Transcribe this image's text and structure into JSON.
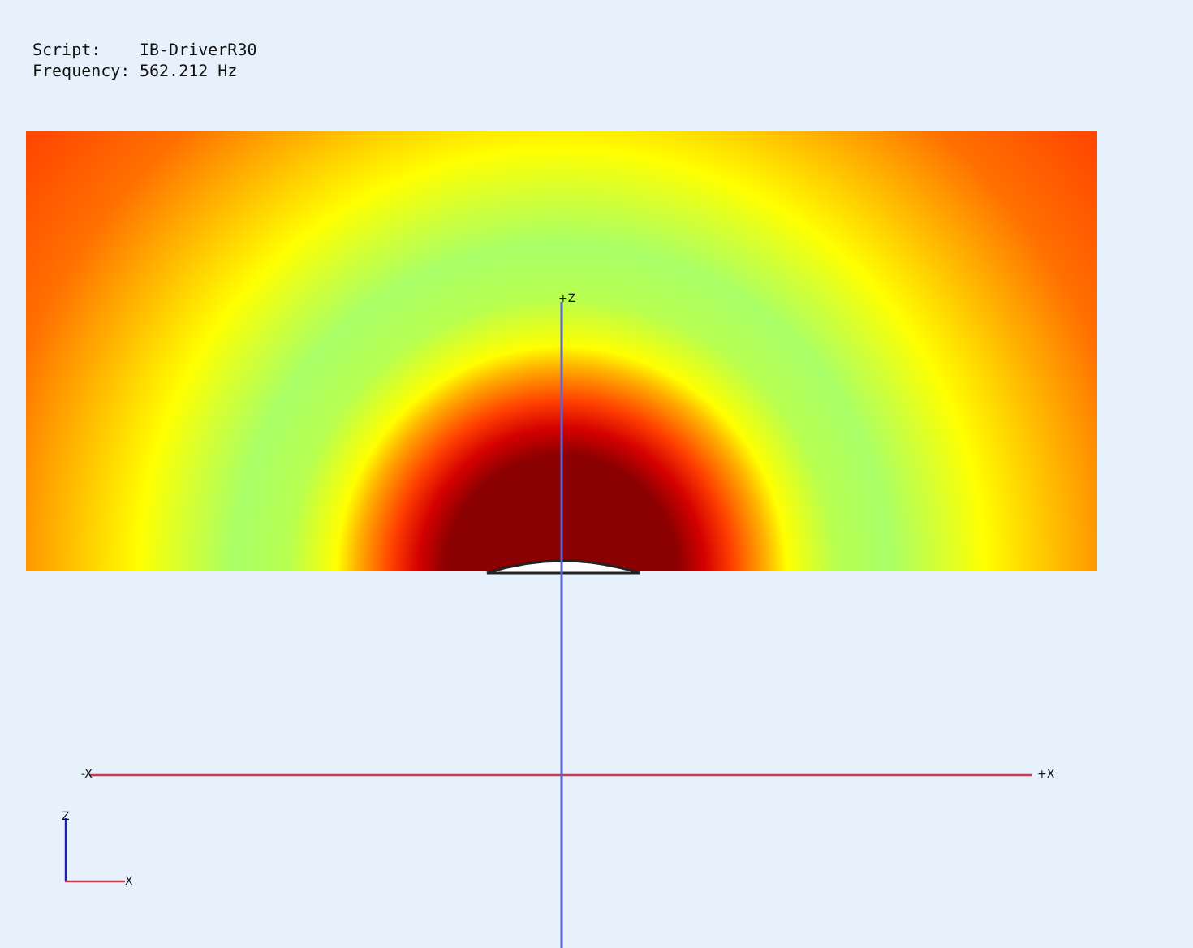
{
  "info": [
    {
      "label": "Script:",
      "value": "IB-DriverR30"
    },
    {
      "label": "Frequency:",
      "value": "562.212 Hz"
    }
  ],
  "axes": {
    "minus_x": "-X",
    "plus_x": "+X",
    "plus_z": "+Z"
  },
  "triad": {
    "vertical": "Z",
    "horizontal": "X"
  }
}
